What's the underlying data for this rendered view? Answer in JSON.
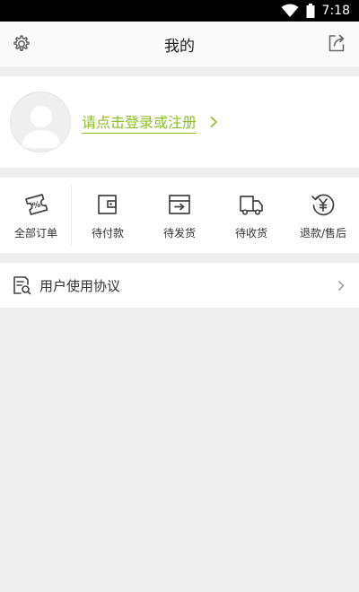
{
  "statusbar": {
    "time": "7:18"
  },
  "header": {
    "title": "我的"
  },
  "profile": {
    "login_text": "请点击登录或注册"
  },
  "orders": [
    {
      "label": "全部订单",
      "icon": "ticket-percent-icon"
    },
    {
      "label": "待付款",
      "icon": "wallet-icon"
    },
    {
      "label": "待发货",
      "icon": "box-arrow-icon"
    },
    {
      "label": "待收货",
      "icon": "truck-icon"
    },
    {
      "label": "退款/售后",
      "icon": "refund-yen-icon"
    }
  ],
  "menu": {
    "user_agreement": "用户使用协议"
  },
  "colors": {
    "accent": "#8cc026",
    "background": "#efefef"
  }
}
